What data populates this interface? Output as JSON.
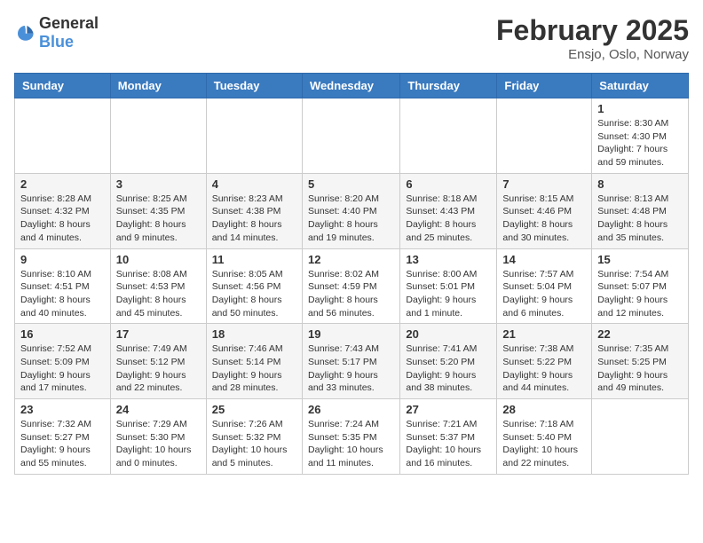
{
  "logo": {
    "general": "General",
    "blue": "Blue"
  },
  "header": {
    "month": "February 2025",
    "location": "Ensjo, Oslo, Norway"
  },
  "weekdays": [
    "Sunday",
    "Monday",
    "Tuesday",
    "Wednesday",
    "Thursday",
    "Friday",
    "Saturday"
  ],
  "weeks": [
    [
      {
        "day": "",
        "info": ""
      },
      {
        "day": "",
        "info": ""
      },
      {
        "day": "",
        "info": ""
      },
      {
        "day": "",
        "info": ""
      },
      {
        "day": "",
        "info": ""
      },
      {
        "day": "",
        "info": ""
      },
      {
        "day": "1",
        "info": "Sunrise: 8:30 AM\nSunset: 4:30 PM\nDaylight: 7 hours and 59 minutes."
      }
    ],
    [
      {
        "day": "2",
        "info": "Sunrise: 8:28 AM\nSunset: 4:32 PM\nDaylight: 8 hours and 4 minutes."
      },
      {
        "day": "3",
        "info": "Sunrise: 8:25 AM\nSunset: 4:35 PM\nDaylight: 8 hours and 9 minutes."
      },
      {
        "day": "4",
        "info": "Sunrise: 8:23 AM\nSunset: 4:38 PM\nDaylight: 8 hours and 14 minutes."
      },
      {
        "day": "5",
        "info": "Sunrise: 8:20 AM\nSunset: 4:40 PM\nDaylight: 8 hours and 19 minutes."
      },
      {
        "day": "6",
        "info": "Sunrise: 8:18 AM\nSunset: 4:43 PM\nDaylight: 8 hours and 25 minutes."
      },
      {
        "day": "7",
        "info": "Sunrise: 8:15 AM\nSunset: 4:46 PM\nDaylight: 8 hours and 30 minutes."
      },
      {
        "day": "8",
        "info": "Sunrise: 8:13 AM\nSunset: 4:48 PM\nDaylight: 8 hours and 35 minutes."
      }
    ],
    [
      {
        "day": "9",
        "info": "Sunrise: 8:10 AM\nSunset: 4:51 PM\nDaylight: 8 hours and 40 minutes."
      },
      {
        "day": "10",
        "info": "Sunrise: 8:08 AM\nSunset: 4:53 PM\nDaylight: 8 hours and 45 minutes."
      },
      {
        "day": "11",
        "info": "Sunrise: 8:05 AM\nSunset: 4:56 PM\nDaylight: 8 hours and 50 minutes."
      },
      {
        "day": "12",
        "info": "Sunrise: 8:02 AM\nSunset: 4:59 PM\nDaylight: 8 hours and 56 minutes."
      },
      {
        "day": "13",
        "info": "Sunrise: 8:00 AM\nSunset: 5:01 PM\nDaylight: 9 hours and 1 minute."
      },
      {
        "day": "14",
        "info": "Sunrise: 7:57 AM\nSunset: 5:04 PM\nDaylight: 9 hours and 6 minutes."
      },
      {
        "day": "15",
        "info": "Sunrise: 7:54 AM\nSunset: 5:07 PM\nDaylight: 9 hours and 12 minutes."
      }
    ],
    [
      {
        "day": "16",
        "info": "Sunrise: 7:52 AM\nSunset: 5:09 PM\nDaylight: 9 hours and 17 minutes."
      },
      {
        "day": "17",
        "info": "Sunrise: 7:49 AM\nSunset: 5:12 PM\nDaylight: 9 hours and 22 minutes."
      },
      {
        "day": "18",
        "info": "Sunrise: 7:46 AM\nSunset: 5:14 PM\nDaylight: 9 hours and 28 minutes."
      },
      {
        "day": "19",
        "info": "Sunrise: 7:43 AM\nSunset: 5:17 PM\nDaylight: 9 hours and 33 minutes."
      },
      {
        "day": "20",
        "info": "Sunrise: 7:41 AM\nSunset: 5:20 PM\nDaylight: 9 hours and 38 minutes."
      },
      {
        "day": "21",
        "info": "Sunrise: 7:38 AM\nSunset: 5:22 PM\nDaylight: 9 hours and 44 minutes."
      },
      {
        "day": "22",
        "info": "Sunrise: 7:35 AM\nSunset: 5:25 PM\nDaylight: 9 hours and 49 minutes."
      }
    ],
    [
      {
        "day": "23",
        "info": "Sunrise: 7:32 AM\nSunset: 5:27 PM\nDaylight: 9 hours and 55 minutes."
      },
      {
        "day": "24",
        "info": "Sunrise: 7:29 AM\nSunset: 5:30 PM\nDaylight: 10 hours and 0 minutes."
      },
      {
        "day": "25",
        "info": "Sunrise: 7:26 AM\nSunset: 5:32 PM\nDaylight: 10 hours and 5 minutes."
      },
      {
        "day": "26",
        "info": "Sunrise: 7:24 AM\nSunset: 5:35 PM\nDaylight: 10 hours and 11 minutes."
      },
      {
        "day": "27",
        "info": "Sunrise: 7:21 AM\nSunset: 5:37 PM\nDaylight: 10 hours and 16 minutes."
      },
      {
        "day": "28",
        "info": "Sunrise: 7:18 AM\nSunset: 5:40 PM\nDaylight: 10 hours and 22 minutes."
      },
      {
        "day": "",
        "info": ""
      }
    ]
  ]
}
